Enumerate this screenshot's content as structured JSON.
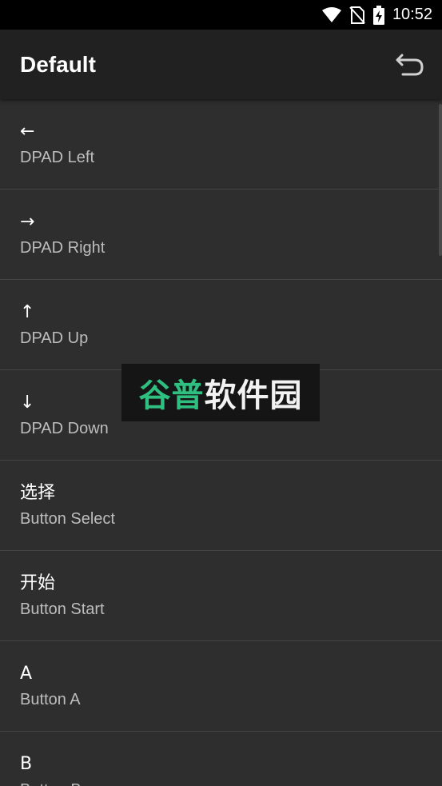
{
  "status_bar": {
    "time": "10:52",
    "icons": [
      "wifi-icon",
      "no-sim-icon",
      "battery-charging-icon"
    ]
  },
  "app_bar": {
    "title": "Default",
    "action_icon": "undo-icon"
  },
  "items": [
    {
      "symbol": "←",
      "label": "DPAD Left"
    },
    {
      "symbol": "→",
      "label": "DPAD Right"
    },
    {
      "symbol": "↑",
      "label": "DPAD Up"
    },
    {
      "symbol": "↓",
      "label": "DPAD Down"
    },
    {
      "symbol": "选择",
      "label": "Button Select"
    },
    {
      "symbol": "开始",
      "label": "Button Start"
    },
    {
      "symbol": "A",
      "label": "Button A"
    },
    {
      "symbol": "B",
      "label": "Button B"
    }
  ],
  "watermark": {
    "text_green": "谷普",
    "text_white": "软件园"
  },
  "colors": {
    "background": "#2e2e2e",
    "app_bar": "#212121",
    "status_bar": "#000000",
    "divider": "#454545",
    "watermark_green": "#2fc081"
  }
}
